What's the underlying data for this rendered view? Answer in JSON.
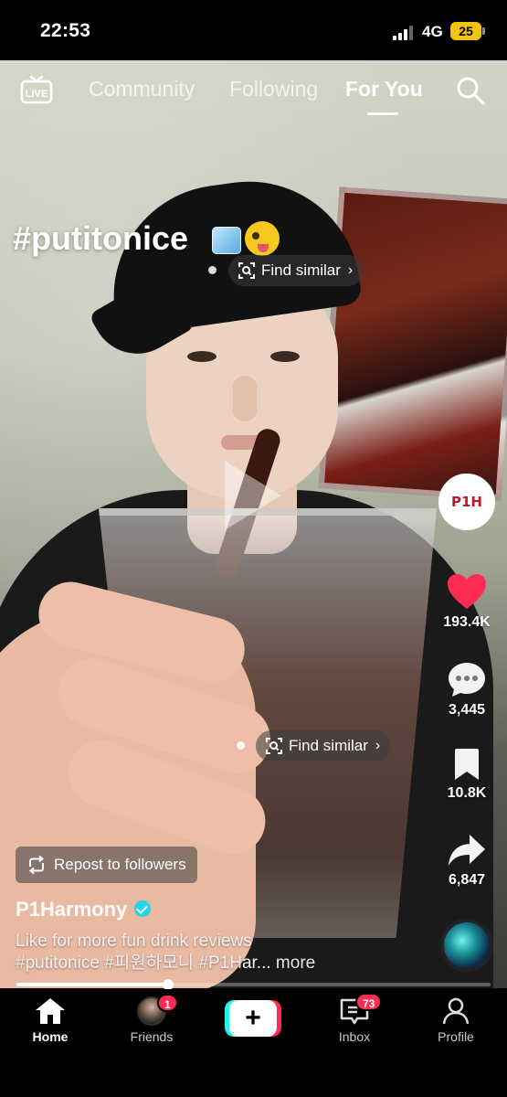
{
  "status_bar": {
    "time": "22:53",
    "network": "4G",
    "battery": "25"
  },
  "top_nav": {
    "live_label": "LIVE",
    "tabs": [
      {
        "label": "Community",
        "active": false
      },
      {
        "label": "Following",
        "active": false
      },
      {
        "label": "For You",
        "active": true
      }
    ]
  },
  "video": {
    "hashtag_title": "#putitonice",
    "find_similar_label": "Find similar"
  },
  "actions": {
    "creator_logo": "P1H",
    "likes": "193.4K",
    "comments": "3,445",
    "saves": "10.8K",
    "shares": "6,847"
  },
  "caption": {
    "repost_label": "Repost to followers",
    "username": "P1Harmony",
    "line1": "Like for more fun drink reviews",
    "line2": "#putitonice #피원하모니 #P1Har...",
    "more": "more"
  },
  "playback": {
    "progress": 0.32
  },
  "bottom_nav": {
    "home": "Home",
    "friends": "Friends",
    "friends_badge": "1",
    "inbox": "Inbox",
    "inbox_badge": "73",
    "profile": "Profile"
  },
  "colors": {
    "accent_red": "#fe2c55",
    "accent_cyan": "#25f4ee",
    "verified": "#20d5ec",
    "battery": "#f1c40f"
  }
}
